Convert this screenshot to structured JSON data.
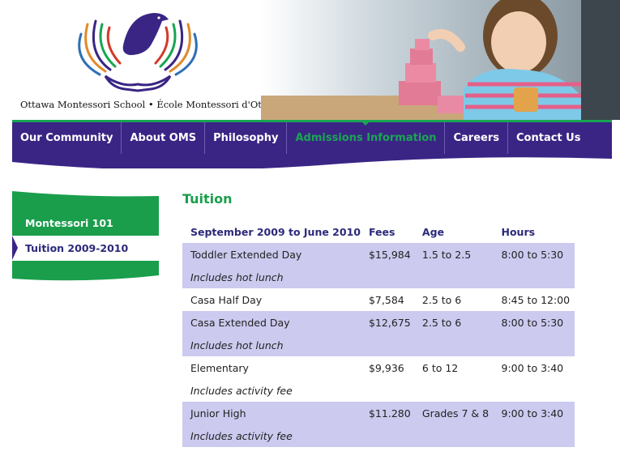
{
  "header": {
    "tagline": "Ottawa Montessori School • École Montessori d'Ottawa"
  },
  "nav": {
    "items": [
      {
        "label": "Our Community"
      },
      {
        "label": "About OMS"
      },
      {
        "label": "Philosophy"
      },
      {
        "label": "Admissions Information",
        "active": true
      },
      {
        "label": "Careers"
      },
      {
        "label": "Contact Us"
      }
    ]
  },
  "sidebar": {
    "items": [
      {
        "label": "Montessori 101"
      },
      {
        "label": "Tuition 2009-2010",
        "current": true
      }
    ]
  },
  "content": {
    "title": "Tuition",
    "table": {
      "headers": [
        "September 2009 to June 2010",
        "Fees",
        "Age",
        "Hours"
      ],
      "rows": [
        {
          "program": "Toddler Extended Day",
          "fee": "$15,984",
          "age": "1.5 to 2.5",
          "hours": "8:00 to 5:30",
          "note": "Includes hot lunch"
        },
        {
          "program": "Casa Half Day",
          "fee": "$7,584",
          "age": "2.5 to 6",
          "hours": "8:45 to 12:00"
        },
        {
          "program": "Casa Extended Day",
          "fee": "$12,675",
          "age": "2.5 to 6",
          "hours": "8:00 to 5:30",
          "note": "Includes hot lunch"
        },
        {
          "program": "Elementary",
          "fee": "$9,936",
          "age": "6 to 12",
          "hours": "9:00 to 3:40",
          "note": "Includes activity fee"
        },
        {
          "program": "Junior High",
          "fee": "$11.280",
          "age": "Grades 7 & 8",
          "hours": "9:00 to 3:40",
          "note": "Includes activity fee"
        }
      ]
    }
  },
  "colors": {
    "nav_purple": "#3a2585",
    "accent_green": "#1a9e4c",
    "row_shade": "#cccaef"
  }
}
